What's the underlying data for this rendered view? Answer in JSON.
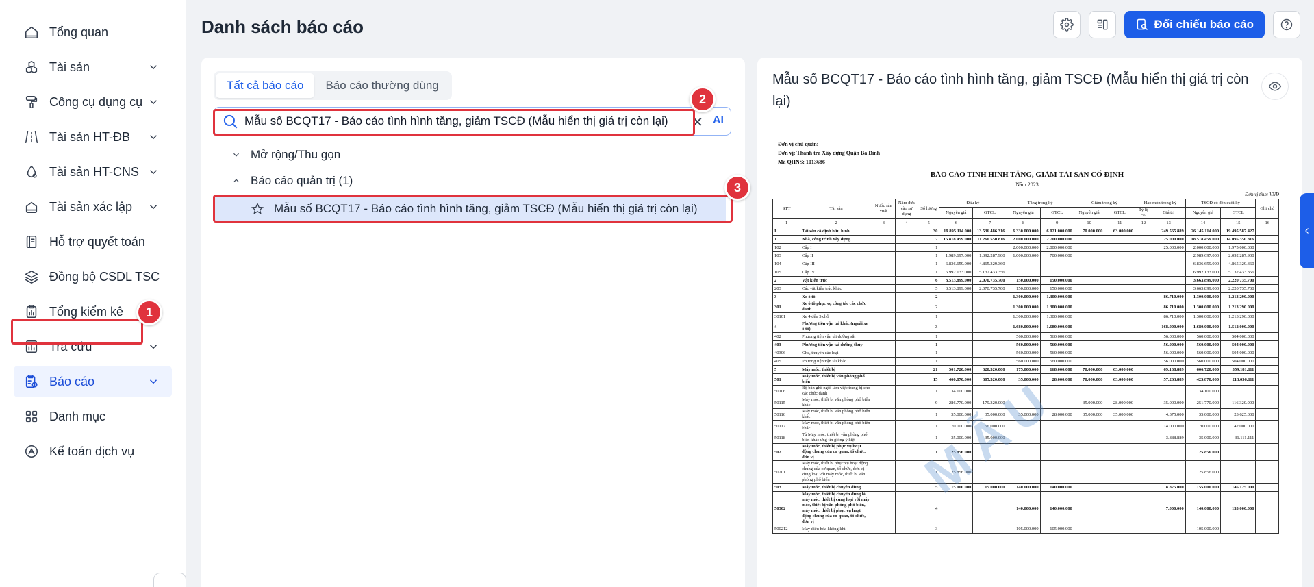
{
  "sidebar": {
    "items": [
      {
        "label": "Tổng quan",
        "icon": "home-icon",
        "chevron": false
      },
      {
        "label": "Tài sản",
        "icon": "cubes-icon",
        "chevron": true
      },
      {
        "label": "Công cụ dụng cụ",
        "icon": "paint-roller-icon",
        "chevron": true
      },
      {
        "label": "Tài sản HT-ĐB",
        "icon": "road-icon",
        "chevron": true
      },
      {
        "label": "Tài sản HT-CNS",
        "icon": "water-drop-icon",
        "chevron": true
      },
      {
        "label": "Tài sản xác lập",
        "icon": "house-icon",
        "chevron": true
      },
      {
        "label": "Hỗ trợ quyết toán",
        "icon": "ledger-icon",
        "chevron": false
      },
      {
        "label": "Đồng bộ CSDL TSC",
        "icon": "layers-sync-icon",
        "chevron": false
      },
      {
        "label": "Tổng kiểm kê",
        "icon": "clipboard-chart-icon",
        "chevron": true
      },
      {
        "label": "Tra cứu",
        "icon": "bar-chart-icon",
        "chevron": true
      },
      {
        "label": "Báo cáo",
        "icon": "report-clipboard-icon",
        "chevron": true
      },
      {
        "label": "Danh mục",
        "icon": "grid-icon",
        "chevron": false
      },
      {
        "label": "Kế toán dịch vụ",
        "icon": "accounting-icon",
        "chevron": false
      }
    ],
    "active_index": 10
  },
  "header": {
    "title": "Danh sách báo cáo",
    "compare_button": "Đối chiếu báo cáo"
  },
  "badges": {
    "one": "1",
    "two": "2",
    "three": "3"
  },
  "left_panel": {
    "tabs": [
      "Tất cả báo cáo",
      "Báo cáo thường dùng"
    ],
    "search_value": "Mẫu số BCQT17 - Báo cáo tình hình tăng, giảm TSCĐ (Mẫu hiển thị giá trị còn lại)",
    "clear_glyph": "✕",
    "ai_label": "AI",
    "expand_label": "Mở rộng/Thu gọn",
    "group_label": "Báo cáo quản trị (1)",
    "item_label": "Mẫu số BCQT17 - Báo cáo tình hình tăng, giảm TSCĐ (Mẫu hiển thị giá trị còn lại)"
  },
  "right_panel": {
    "title": "Mẫu số BCQT17 - Báo cáo tình hình tăng, giảm TSCĐ (Mẫu hiển thị giá trị còn lại)",
    "doc": {
      "agency_label": "Đơn vị chủ quản:",
      "unit_label": "Đơn vị: Thanh tra Xây dựng Quận Ba Đình",
      "code_label": "Mã QHNS: 1013686",
      "title": "BÁO CÁO TÌNH HÌNH TĂNG, GIẢM TÀI SẢN CỐ ĐỊNH",
      "year": "Năm 2023",
      "currency": "Đơn vị tính: VNĐ",
      "watermark": "MẪU",
      "headers_top": [
        "STT",
        "Tài sản",
        "Nước sản xuất",
        "Năm đưa vào sử dụng",
        "Số lượng",
        "Đầu kỳ",
        "Tăng trong kỳ",
        "Giảm trong kỳ",
        "Hao mòn trong kỳ",
        "TSCĐ có đến cuối kỳ",
        "Ghi chú"
      ],
      "headers_sub": [
        "Nguyên giá",
        "GTCL",
        "Nguyên giá",
        "GTCL",
        "Nguyên giá",
        "GTCL",
        "Tỷ lệ %",
        "Giá trị",
        "Nguyên giá",
        "GTCL"
      ],
      "col_numbers": [
        "1",
        "2",
        "3",
        "4",
        "5",
        "6",
        "7",
        "8",
        "9",
        "10",
        "11",
        "12",
        "13",
        "14",
        "15",
        "16"
      ],
      "rows": [
        {
          "b": true,
          "c": [
            "I",
            "Tài sản cố định hữu hình",
            "",
            "",
            "30",
            "19.895.114.000",
            "13.536.486.316",
            "6.330.000.000",
            "6.021.000.000",
            "70.000.000",
            "63.000.000",
            "",
            "249.565.889",
            "26.145.114.000",
            "19.495.587.427",
            ""
          ]
        },
        {
          "b": true,
          "c": [
            "1",
            "Nhà, công trình xây dựng",
            "",
            "",
            "7",
            "15.818.459.000",
            "11.260.550.816",
            "2.000.000.000",
            "2.700.000.000",
            "",
            "",
            "",
            "25.000.000",
            "18.518.459.000",
            "14.095.350.816",
            ""
          ]
        },
        {
          "b": false,
          "c": [
            "102",
            "Cấp I",
            "",
            "",
            "1",
            "",
            "",
            "2.000.000.000",
            "2.000.000.000",
            "",
            "",
            "",
            "25.000.000",
            "2.000.000.000",
            "1.975.000.000",
            ""
          ]
        },
        {
          "b": false,
          "c": [
            "103",
            "Cấp II",
            "",
            "",
            "1",
            "1.989.697.000",
            "1.392.287.900",
            "1.000.000.000",
            "700.000.000",
            "",
            "",
            "",
            "",
            "2.989.697.000",
            "2.092.287.900",
            ""
          ]
        },
        {
          "b": false,
          "c": [
            "104",
            "Cấp III",
            "",
            "",
            "1",
            "6.836.659.000",
            "4.865.329.360",
            "",
            "",
            "",
            "",
            "",
            "",
            "6.836.659.000",
            "4.865.329.360",
            ""
          ]
        },
        {
          "b": false,
          "c": [
            "105",
            "Cấp IV",
            "",
            "",
            "1",
            "6.992.133.000",
            "5.132.433.356",
            "",
            "",
            "",
            "",
            "",
            "",
            "6.992.133.000",
            "5.132.433.356",
            ""
          ]
        },
        {
          "b": true,
          "c": [
            "2",
            "Vật kiến trúc",
            "",
            "",
            "6",
            "3.513.899.000",
            "2.070.735.700",
            "150.000.000",
            "150.000.000",
            "",
            "",
            "",
            "",
            "3.663.899.000",
            "2.220.735.700",
            ""
          ]
        },
        {
          "b": false,
          "c": [
            "203",
            "Các vật kiến trúc khác",
            "",
            "",
            "5",
            "3.513.899.000",
            "2.070.735.700",
            "150.000.000",
            "150.000.000",
            "",
            "",
            "",
            "",
            "3.663.899.000",
            "2.220.735.700",
            ""
          ]
        },
        {
          "b": true,
          "c": [
            "3",
            "Xe ô tô",
            "",
            "",
            "2",
            "",
            "",
            "1.300.000.000",
            "1.300.000.000",
            "",
            "",
            "",
            "86.710.000",
            "1.300.000.000",
            "1.213.290.000",
            ""
          ]
        },
        {
          "b": true,
          "c": [
            "301",
            "Xe ô tô phục vụ công tác các chức danh",
            "",
            "",
            "2",
            "",
            "",
            "1.300.000.000",
            "1.300.000.000",
            "",
            "",
            "",
            "86.710.000",
            "1.300.000.000",
            "1.213.290.000",
            ""
          ]
        },
        {
          "b": false,
          "c": [
            "30101",
            "Xe 4 đến 5 chỗ",
            "",
            "",
            "1",
            "",
            "",
            "1.300.000.000",
            "1.300.000.000",
            "",
            "",
            "",
            "86.710.000",
            "1.300.000.000",
            "1.213.290.000",
            ""
          ]
        },
        {
          "b": true,
          "c": [
            "4",
            "Phương tiện vận tải khác (ngoài xe ô tô)",
            "",
            "",
            "3",
            "",
            "",
            "1.680.000.000",
            "1.680.000.000",
            "",
            "",
            "",
            "168.000.000",
            "1.680.000.000",
            "1.512.000.000",
            ""
          ]
        },
        {
          "b": false,
          "c": [
            "402",
            "Phương tiện vận tải đường sắt",
            "",
            "",
            "1",
            "",
            "",
            "560.000.000",
            "560.000.000",
            "",
            "",
            "",
            "56.000.000",
            "560.000.000",
            "504.000.000",
            ""
          ]
        },
        {
          "b": true,
          "c": [
            "403",
            "Phương tiện vận tải đường thủy",
            "",
            "",
            "1",
            "",
            "",
            "560.000.000",
            "560.000.000",
            "",
            "",
            "",
            "56.000.000",
            "560.000.000",
            "504.000.000",
            ""
          ]
        },
        {
          "b": false,
          "c": [
            "40306",
            "Ghe, thuyền các loại",
            "",
            "",
            "1",
            "",
            "",
            "560.000.000",
            "560.000.000",
            "",
            "",
            "",
            "56.000.000",
            "560.000.000",
            "504.000.000",
            ""
          ]
        },
        {
          "b": false,
          "c": [
            "405",
            "Phương tiện vận tải khác",
            "",
            "",
            "1",
            "",
            "",
            "560.000.000",
            "560.000.000",
            "",
            "",
            "",
            "56.000.000",
            "560.000.000",
            "504.000.000",
            ""
          ]
        },
        {
          "b": true,
          "c": [
            "5",
            "Máy móc, thiết bị",
            "",
            "",
            "21",
            "501.720.000",
            "320.320.000",
            "175.000.000",
            "168.000.000",
            "70.000.000",
            "63.000.000",
            "",
            "69.138.889",
            "606.720.000",
            "359.181.111",
            ""
          ]
        },
        {
          "b": true,
          "c": [
            "501",
            "Máy móc, thiết bị văn phòng phổ biến",
            "",
            "",
            "15",
            "460.870.000",
            "305.320.000",
            "35.000.000",
            "28.000.000",
            "70.000.000",
            "63.000.000",
            "",
            "57.263.889",
            "425.870.000",
            "213.056.111",
            ""
          ]
        },
        {
          "b": false,
          "c": [
            "50106",
            "Bộ bàn ghế ngồi làm việc trang bị cho các chức danh",
            "",
            "",
            "1",
            "34.100.000",
            "",
            "",
            "",
            "",
            "",
            "",
            "",
            "34.100.000",
            "",
            ""
          ]
        },
        {
          "b": false,
          "c": [
            "50115",
            "Máy móc, thiết bị văn phòng phổ biến khác",
            "",
            "",
            "9",
            "286.770.000",
            "179.320.000",
            "",
            "",
            "35.000.000",
            "28.000.000",
            "",
            "35.000.000",
            "251.770.000",
            "116.320.000",
            ""
          ]
        },
        {
          "b": false,
          "c": [
            "50116",
            "Máy móc, thiết bị văn phòng phổ biến khác",
            "",
            "",
            "1",
            "35.000.000",
            "35.000.000",
            "35.000.000",
            "28.000.000",
            "35.000.000",
            "35.000.000",
            "",
            "4.375.000",
            "35.000.000",
            "23.625.000",
            ""
          ]
        },
        {
          "b": false,
          "c": [
            "50117",
            "Máy móc, thiết bị văn phòng phổ biến khác",
            "",
            "",
            "1",
            "70.000.000",
            "56.000.000",
            "",
            "",
            "",
            "",
            "",
            "14.000.000",
            "70.000.000",
            "42.000.000",
            ""
          ]
        },
        {
          "b": false,
          "c": [
            "50118",
            "Tủ Máy móc, thiết bị văn phòng phổ biến khác ưng tín giống ý kiệt",
            "",
            "",
            "1",
            "35.000.000",
            "35.000.000",
            "",
            "",
            "",
            "",
            "",
            "3.888.889",
            "35.000.000",
            "31.111.111",
            ""
          ]
        },
        {
          "b": true,
          "c": [
            "502",
            "Máy móc, thiết bị phục vụ hoạt động chung của cơ quan, tổ chức, đơn vị",
            "",
            "",
            "1",
            "25.856.000",
            "",
            "",
            "",
            "",
            "",
            "",
            "",
            "25.856.000",
            "",
            ""
          ]
        },
        {
          "b": false,
          "c": [
            "50201",
            "Máy móc, thiết bị phục vụ hoạt động chung của cơ quan, tổ chức, đơn vị cùng loại với máy móc, thiết bị văn phòng phổ biến",
            "",
            "",
            "1",
            "25.856.000",
            "",
            "",
            "",
            "",
            "",
            "",
            "",
            "25.856.000",
            "",
            ""
          ]
        },
        {
          "b": true,
          "c": [
            "503",
            "Máy móc, thiết bị chuyên dùng",
            "",
            "",
            "5",
            "15.000.000",
            "15.000.000",
            "140.000.000",
            "140.000.000",
            "",
            "",
            "",
            "8.875.000",
            "155.000.000",
            "146.125.000",
            ""
          ]
        },
        {
          "b": true,
          "c": [
            "50302",
            "Máy móc, thiết bị chuyên dùng là máy móc, thiết bị cùng loại với máy móc, thiết bị văn phòng phổ biến, máy móc, thiết bị phục vụ hoạt động chung của cơ quan, tổ chức, đơn vị",
            "",
            "",
            "4",
            "",
            "",
            "140.000.000",
            "140.000.000",
            "",
            "",
            "",
            "7.000.000",
            "140.000.000",
            "133.000.000",
            ""
          ]
        },
        {
          "b": false,
          "c": [
            "500212",
            "Máy điều hòa không khí",
            "",
            "",
            "3",
            "",
            "",
            "105.000.000",
            "105.000.000",
            "",
            "",
            "",
            "",
            "105.000.000",
            "",
            ""
          ]
        }
      ]
    }
  }
}
